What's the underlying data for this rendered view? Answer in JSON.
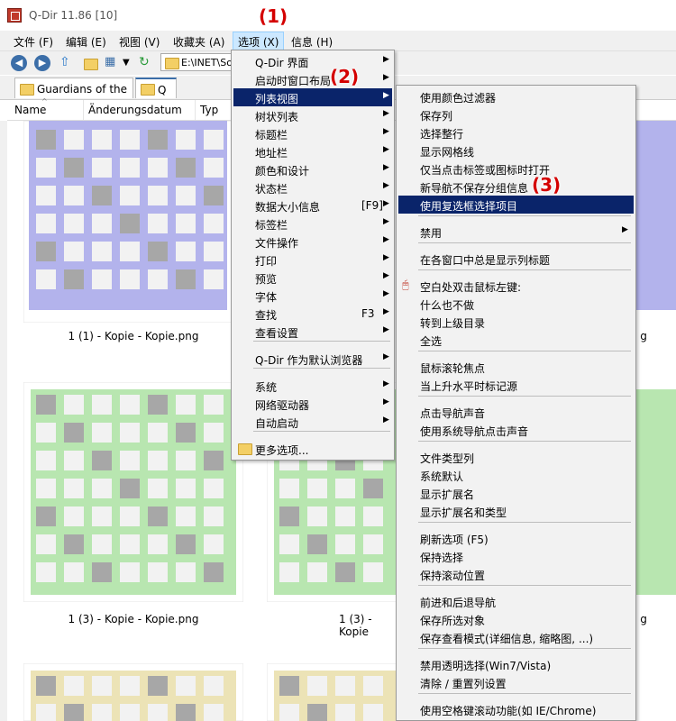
{
  "window": {
    "title": "Q-Dir 11.86 [10]"
  },
  "menubar": [
    "文件 (F)",
    "编辑 (E)",
    "视图 (V)",
    "收藏夹 (A)",
    "选项 (X)",
    "信息 (H)"
  ],
  "address": {
    "path": "E:\\INET\\So"
  },
  "tabs": [
    "Guardians of the ...",
    "Q"
  ],
  "columns": [
    "Name",
    "Änderungsdatum",
    "Typ"
  ],
  "captions": {
    "row1_left": "1 (1) - Kopie - Kopie.png",
    "row1_right_partial": "g",
    "row2_left": "1 (3) - Kopie - Kopie.png",
    "row2_mid_partial": "1 (3) - Kopie",
    "row2_right_partial": "g"
  },
  "options_menu": {
    "items": [
      {
        "label": "Q-Dir 界面",
        "sub": true
      },
      {
        "label": "启动时窗口布局",
        "sub": true
      },
      {
        "label": "列表视图",
        "sub": true,
        "highlight": true
      },
      {
        "label": "树状列表",
        "sub": true
      },
      {
        "label": "标题栏",
        "sub": true
      },
      {
        "label": "地址栏",
        "sub": true
      },
      {
        "label": "颜色和设计",
        "sub": true
      },
      {
        "label": "状态栏",
        "sub": true
      },
      {
        "label": "数据大小信息",
        "shortcut": "[F9]",
        "sub": true
      },
      {
        "label": "标签栏",
        "sub": true
      },
      {
        "label": "文件操作",
        "sub": true
      },
      {
        "label": "打印",
        "sub": true
      },
      {
        "label": "预览",
        "sub": true
      },
      {
        "label": "字体",
        "sub": true
      },
      {
        "label": "查找",
        "shortcut": "F3",
        "sub": true
      },
      {
        "label": "查看设置",
        "sub": true
      },
      {
        "label": "Q-Dir 作为默认浏览器",
        "sub": true
      },
      {
        "label": "系统",
        "sub": true
      },
      {
        "label": "网络驱动器",
        "sub": true
      },
      {
        "label": "自动启动",
        "sub": true
      },
      {
        "label": "更多选项..."
      }
    ]
  },
  "listview_submenu": {
    "items": [
      "使用颜色过滤器",
      "保存列",
      "选择整行",
      "显示网格线",
      "仅当点击标签或图标时打开",
      "新导航不保存分组信息",
      "使用复选框选择项目",
      "禁用",
      "在各窗口中总是显示列标题",
      "空白处双击鼠标左键:",
      "什么也不做",
      "转到上级目录",
      "全选",
      "鼠标滚轮焦点",
      "当上升水平时标记源",
      "点击导航声音",
      "使用系统导航点击声音",
      "文件类型列",
      "系统默认",
      "显示扩展名",
      "显示扩展名和类型",
      "刷新选项 (F5)",
      "保持选择",
      "保持滚动位置",
      "前进和后退导航",
      "保存所选对象",
      "保存查看模式(详细信息, 缩略图, ...)",
      "禁用透明选择(Win7/Vista)",
      "清除 / 重置列设置",
      "使用空格键滚动功能(如 IE/Chrome)"
    ]
  },
  "annotations": [
    "(1)",
    "(2)",
    "(3)"
  ],
  "colors": {
    "highlight": "#0a246a",
    "annotation": "#d40000",
    "purple_tile": "#b3b3ec",
    "green_tile": "#b8e6b0",
    "yellow_tile": "#ece3b6"
  }
}
